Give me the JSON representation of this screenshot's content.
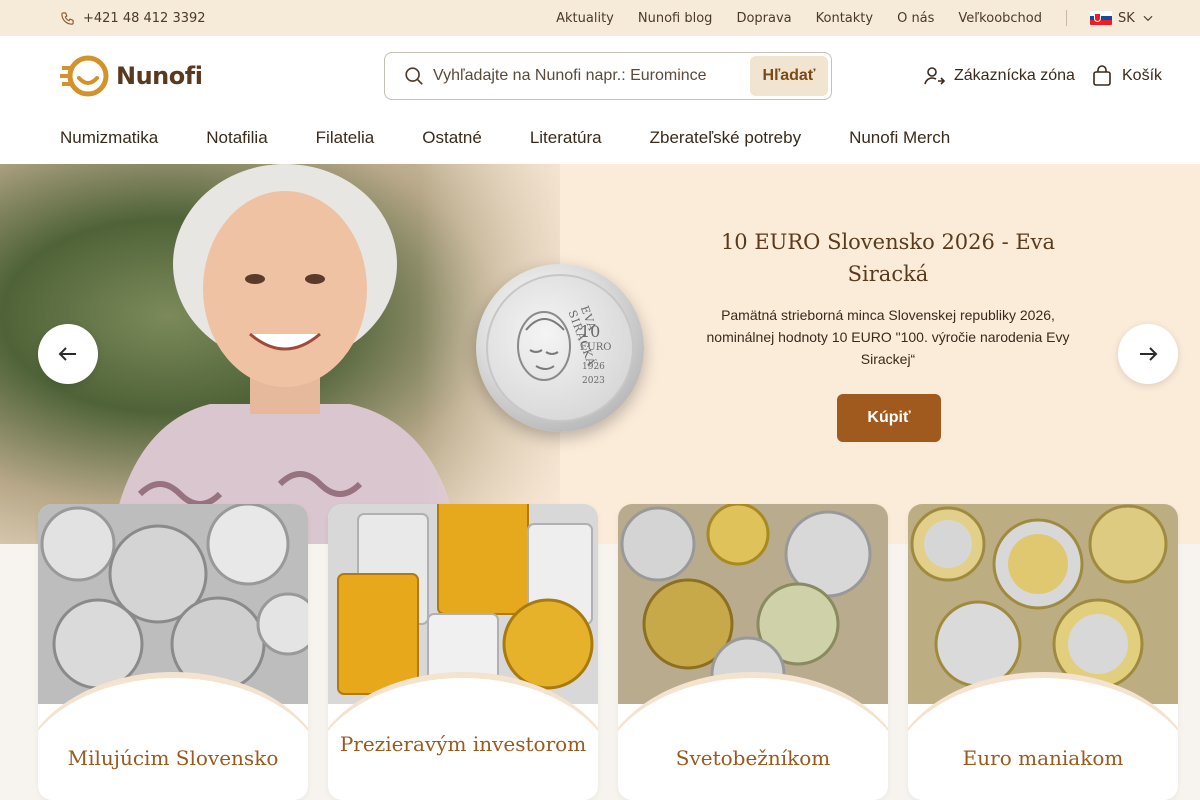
{
  "topbar": {
    "phone": "+421 48 412 3392",
    "links": [
      "Aktuality",
      "Nunofi blog",
      "Doprava",
      "Kontakty",
      "O nás",
      "Veľkoobchod"
    ],
    "language": "SK"
  },
  "header": {
    "logo_text": "Nunofi",
    "search": {
      "placeholder": "Vyhľadajte na Nunofi napr.: Euromince",
      "button": "Hľadať"
    },
    "account_label": "Zákaznícka zóna",
    "cart_label": "Košík"
  },
  "nav": [
    "Numizmatika",
    "Notafilia",
    "Filatelia",
    "Ostatné",
    "Literatúra",
    "Zberateľské potreby",
    "Nunofi Merch"
  ],
  "hero": {
    "title": "10 EURO Slovensko 2026 - Eva Siracká",
    "description": "Pamätná strieborná minca Slovenskej republiky 2026, nominálnej hodnoty 10 EURO \"100. výročie narodenia Evy Sirackej“",
    "cta": "Kúpiť",
    "coin": {
      "value": "10",
      "currency": "EURO",
      "years": [
        "1926",
        "2023"
      ],
      "name": "EVA SIRACKÁ"
    }
  },
  "cards": [
    {
      "title": "Milujúcim Slovensko"
    },
    {
      "title": "Prezieravým investorom"
    },
    {
      "title": "Svetobežníkom"
    },
    {
      "title": "Euro maniakom"
    }
  ],
  "colors": {
    "accent": "#a05a1e",
    "topbar_bg": "#f6ead9",
    "hero_bg": "#fbebd9",
    "card_title": "#9a5a1e"
  }
}
